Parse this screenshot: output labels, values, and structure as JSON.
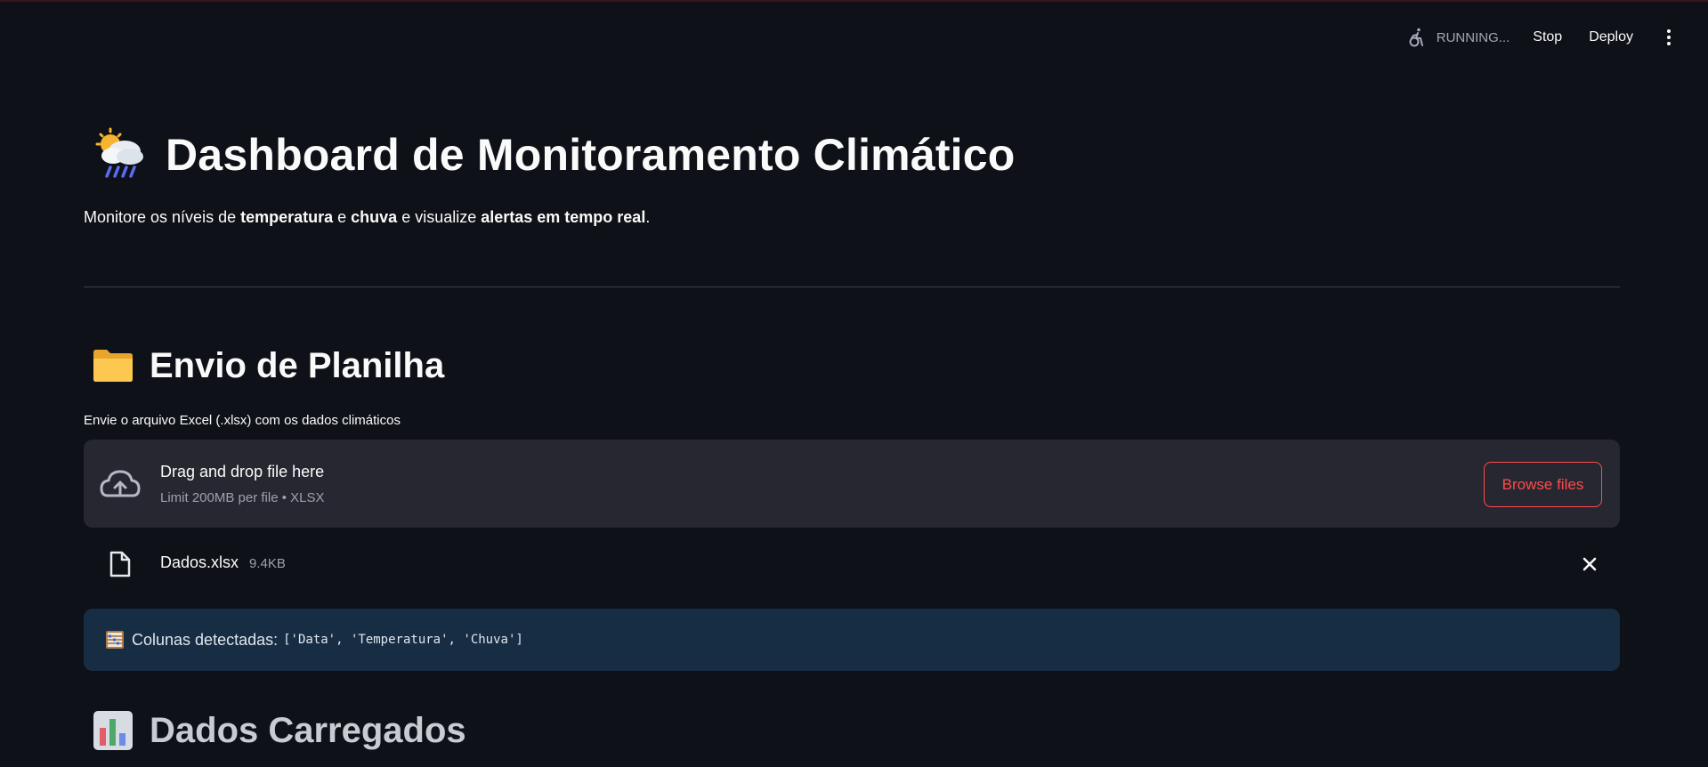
{
  "toolbar": {
    "status": "RUNNING...",
    "stop_label": "Stop",
    "deploy_label": "Deploy"
  },
  "header": {
    "title": "Dashboard de Monitoramento Climático",
    "title_icon": "cloud-rain-sun-emoji",
    "subtitle_parts": [
      "Monitore os níveis de ",
      "temperatura",
      " e ",
      "chuva",
      " e visualize ",
      "alertas em tempo real",
      "."
    ]
  },
  "upload_section": {
    "title": "Envio de Planilha",
    "title_icon": "folder-emoji",
    "label": "Envie o arquivo Excel (.xlsx) com os dados climáticos",
    "dropzone": {
      "title": "Drag and drop file here",
      "subtitle": "Limit 200MB per file • XLSX",
      "browse_label": "Browse files"
    },
    "file": {
      "name": "Dados.xlsx",
      "size": "9.4KB"
    },
    "info": {
      "label": "Colunas detectadas:",
      "code": "['Data', 'Temperatura', 'Chuva']"
    }
  },
  "data_section": {
    "title": "Dados Carregados",
    "title_icon": "bar-chart-emoji"
  },
  "colors": {
    "background": "#0e1117",
    "accent": "#ff4b4b",
    "dropzone_bg": "#262730",
    "info_bg": "#172d43"
  }
}
